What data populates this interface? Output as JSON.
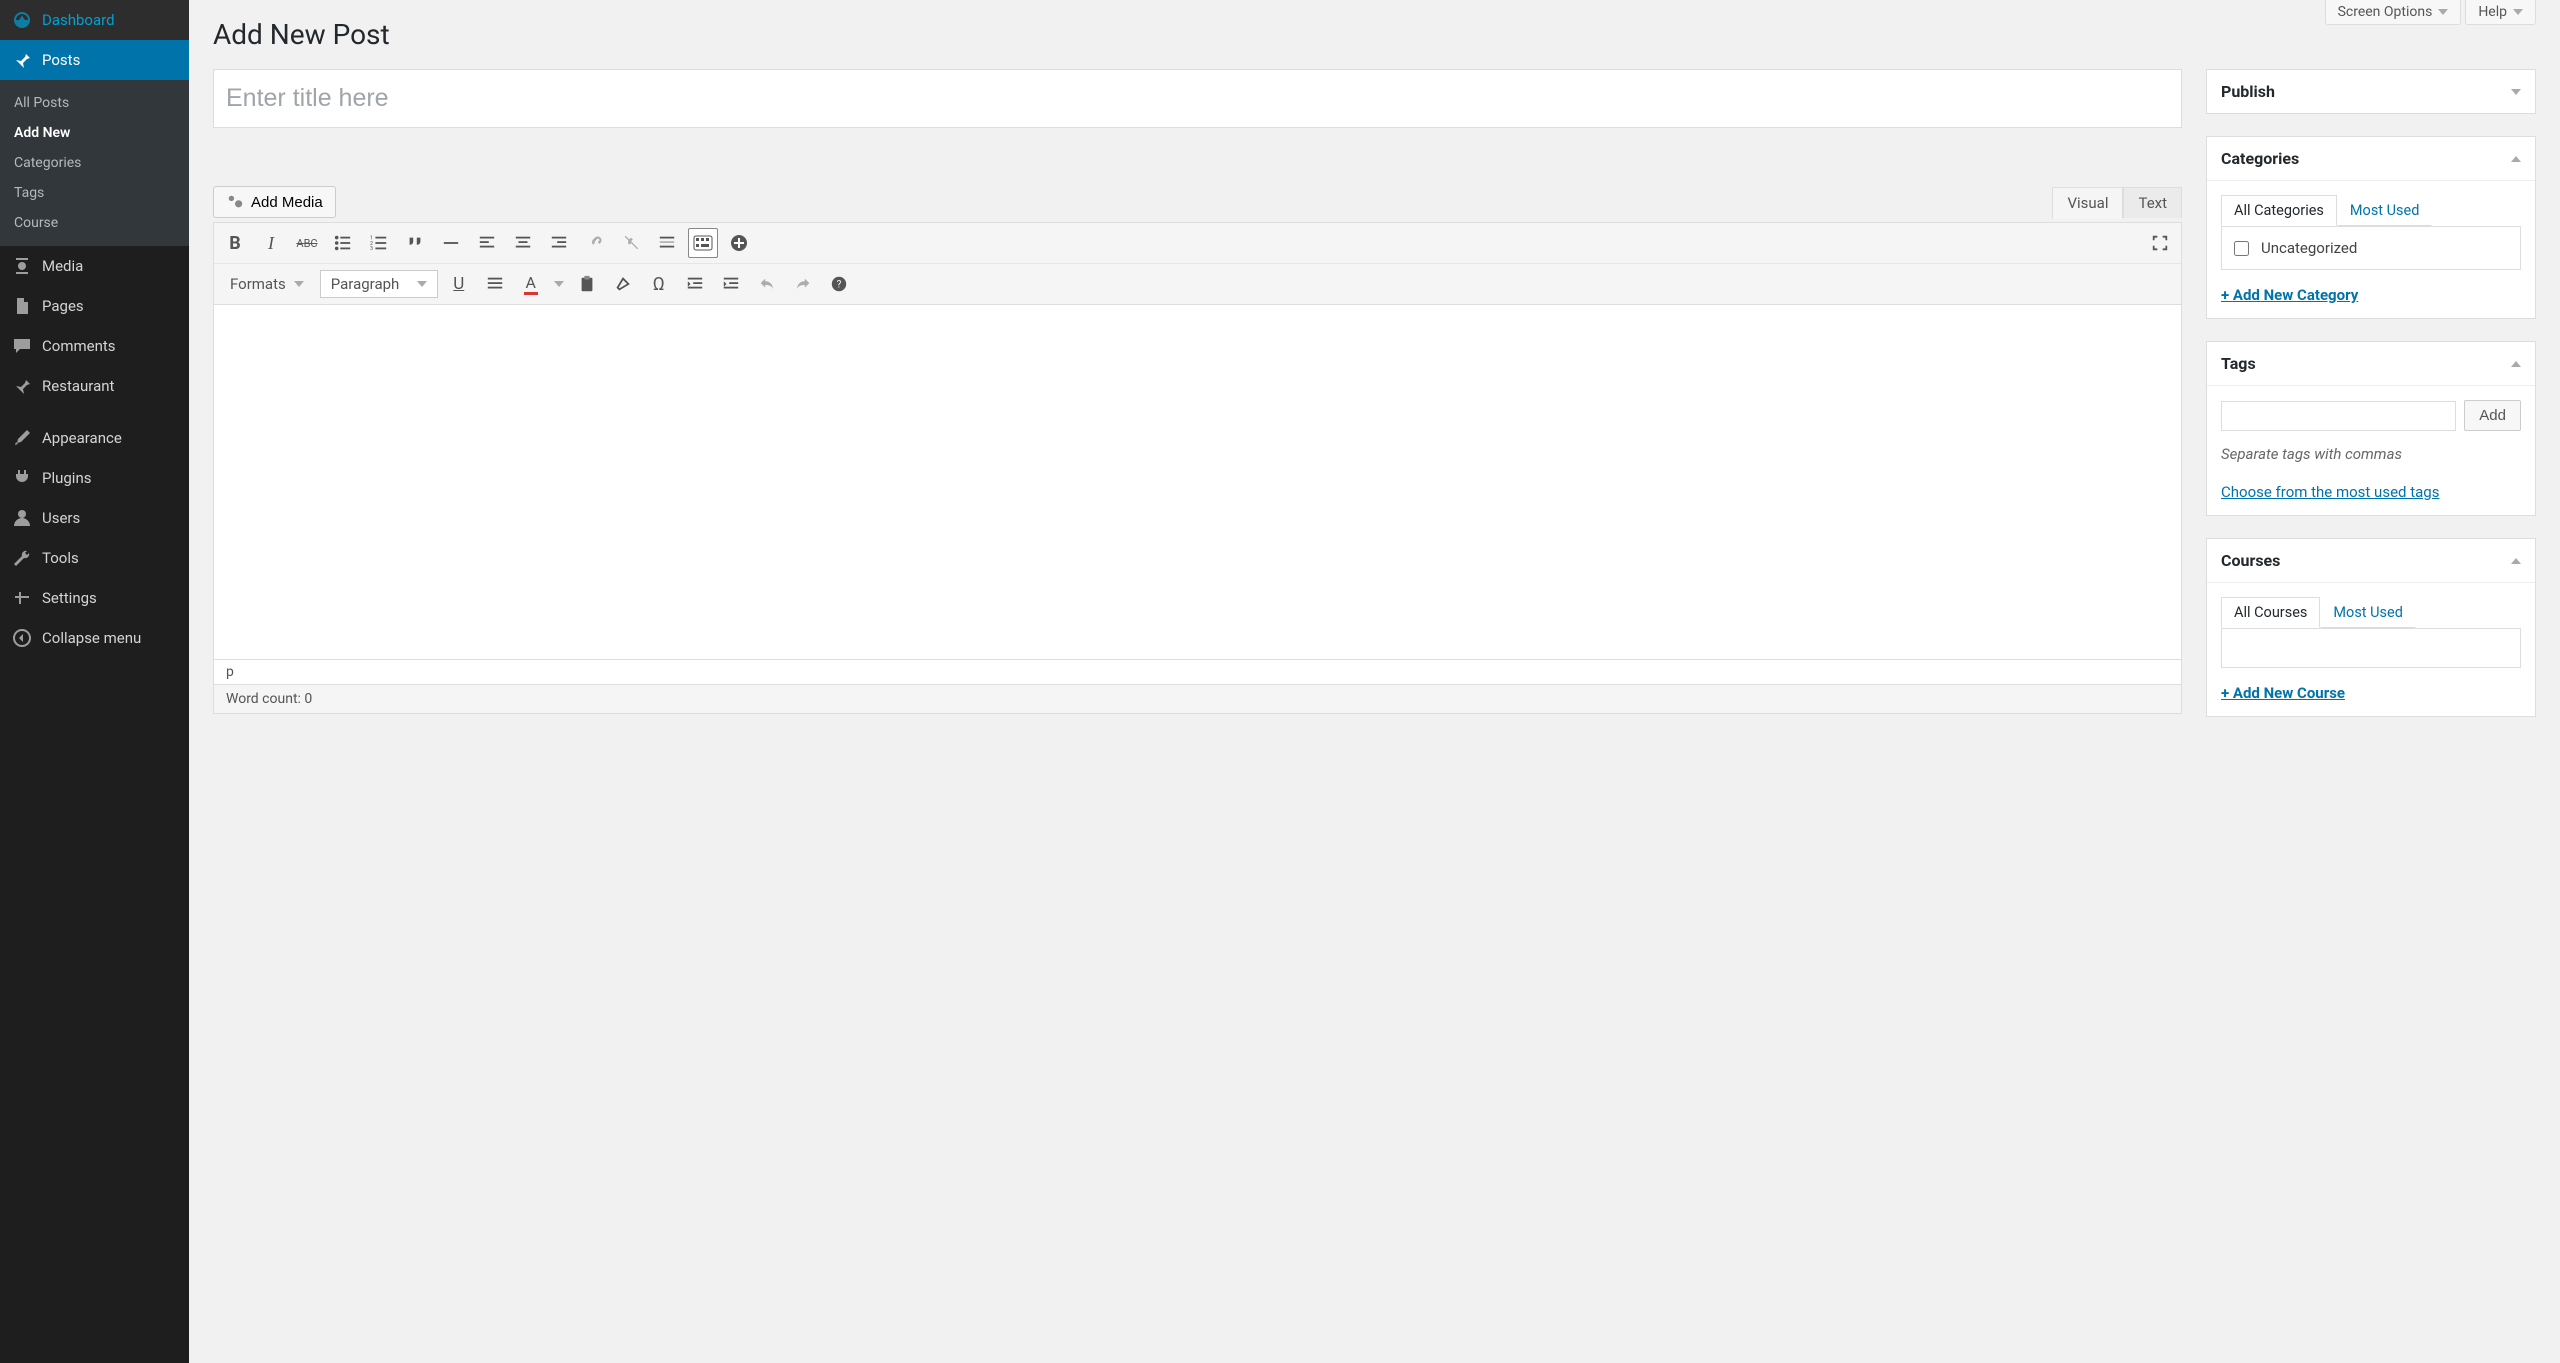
{
  "sidebar": {
    "dashboard": "Dashboard",
    "posts": "Posts",
    "posts_sub": [
      "All Posts",
      "Add New",
      "Categories",
      "Tags",
      "Course"
    ],
    "media": "Media",
    "pages": "Pages",
    "comments": "Comments",
    "restaurant": "Restaurant",
    "appearance": "Appearance",
    "plugins": "Plugins",
    "users": "Users",
    "tools": "Tools",
    "settings": "Settings",
    "collapse": "Collapse menu"
  },
  "toptabs": {
    "screen_options": "Screen Options",
    "help": "Help"
  },
  "page": {
    "title": "Add New Post",
    "title_placeholder": "Enter title here"
  },
  "media_btn": "Add Media",
  "editor_tabs": {
    "visual": "Visual",
    "text": "Text"
  },
  "toolbar": {
    "formats": "Formats",
    "paragraph": "Paragraph"
  },
  "status": {
    "path": "p",
    "word_count": "Word count: 0"
  },
  "publish_box": {
    "title": "Publish"
  },
  "categories_box": {
    "title": "Categories",
    "tab_all": "All Categories",
    "tab_most": "Most Used",
    "items": [
      "Uncategorized"
    ],
    "add_link": "+ Add New Category"
  },
  "tags_box": {
    "title": "Tags",
    "add": "Add",
    "hint": "Separate tags with commas",
    "choose": "Choose from the most used tags"
  },
  "courses_box": {
    "title": "Courses",
    "tab_all": "All Courses",
    "tab_most": "Most Used",
    "add_link": "+ Add New Course"
  }
}
